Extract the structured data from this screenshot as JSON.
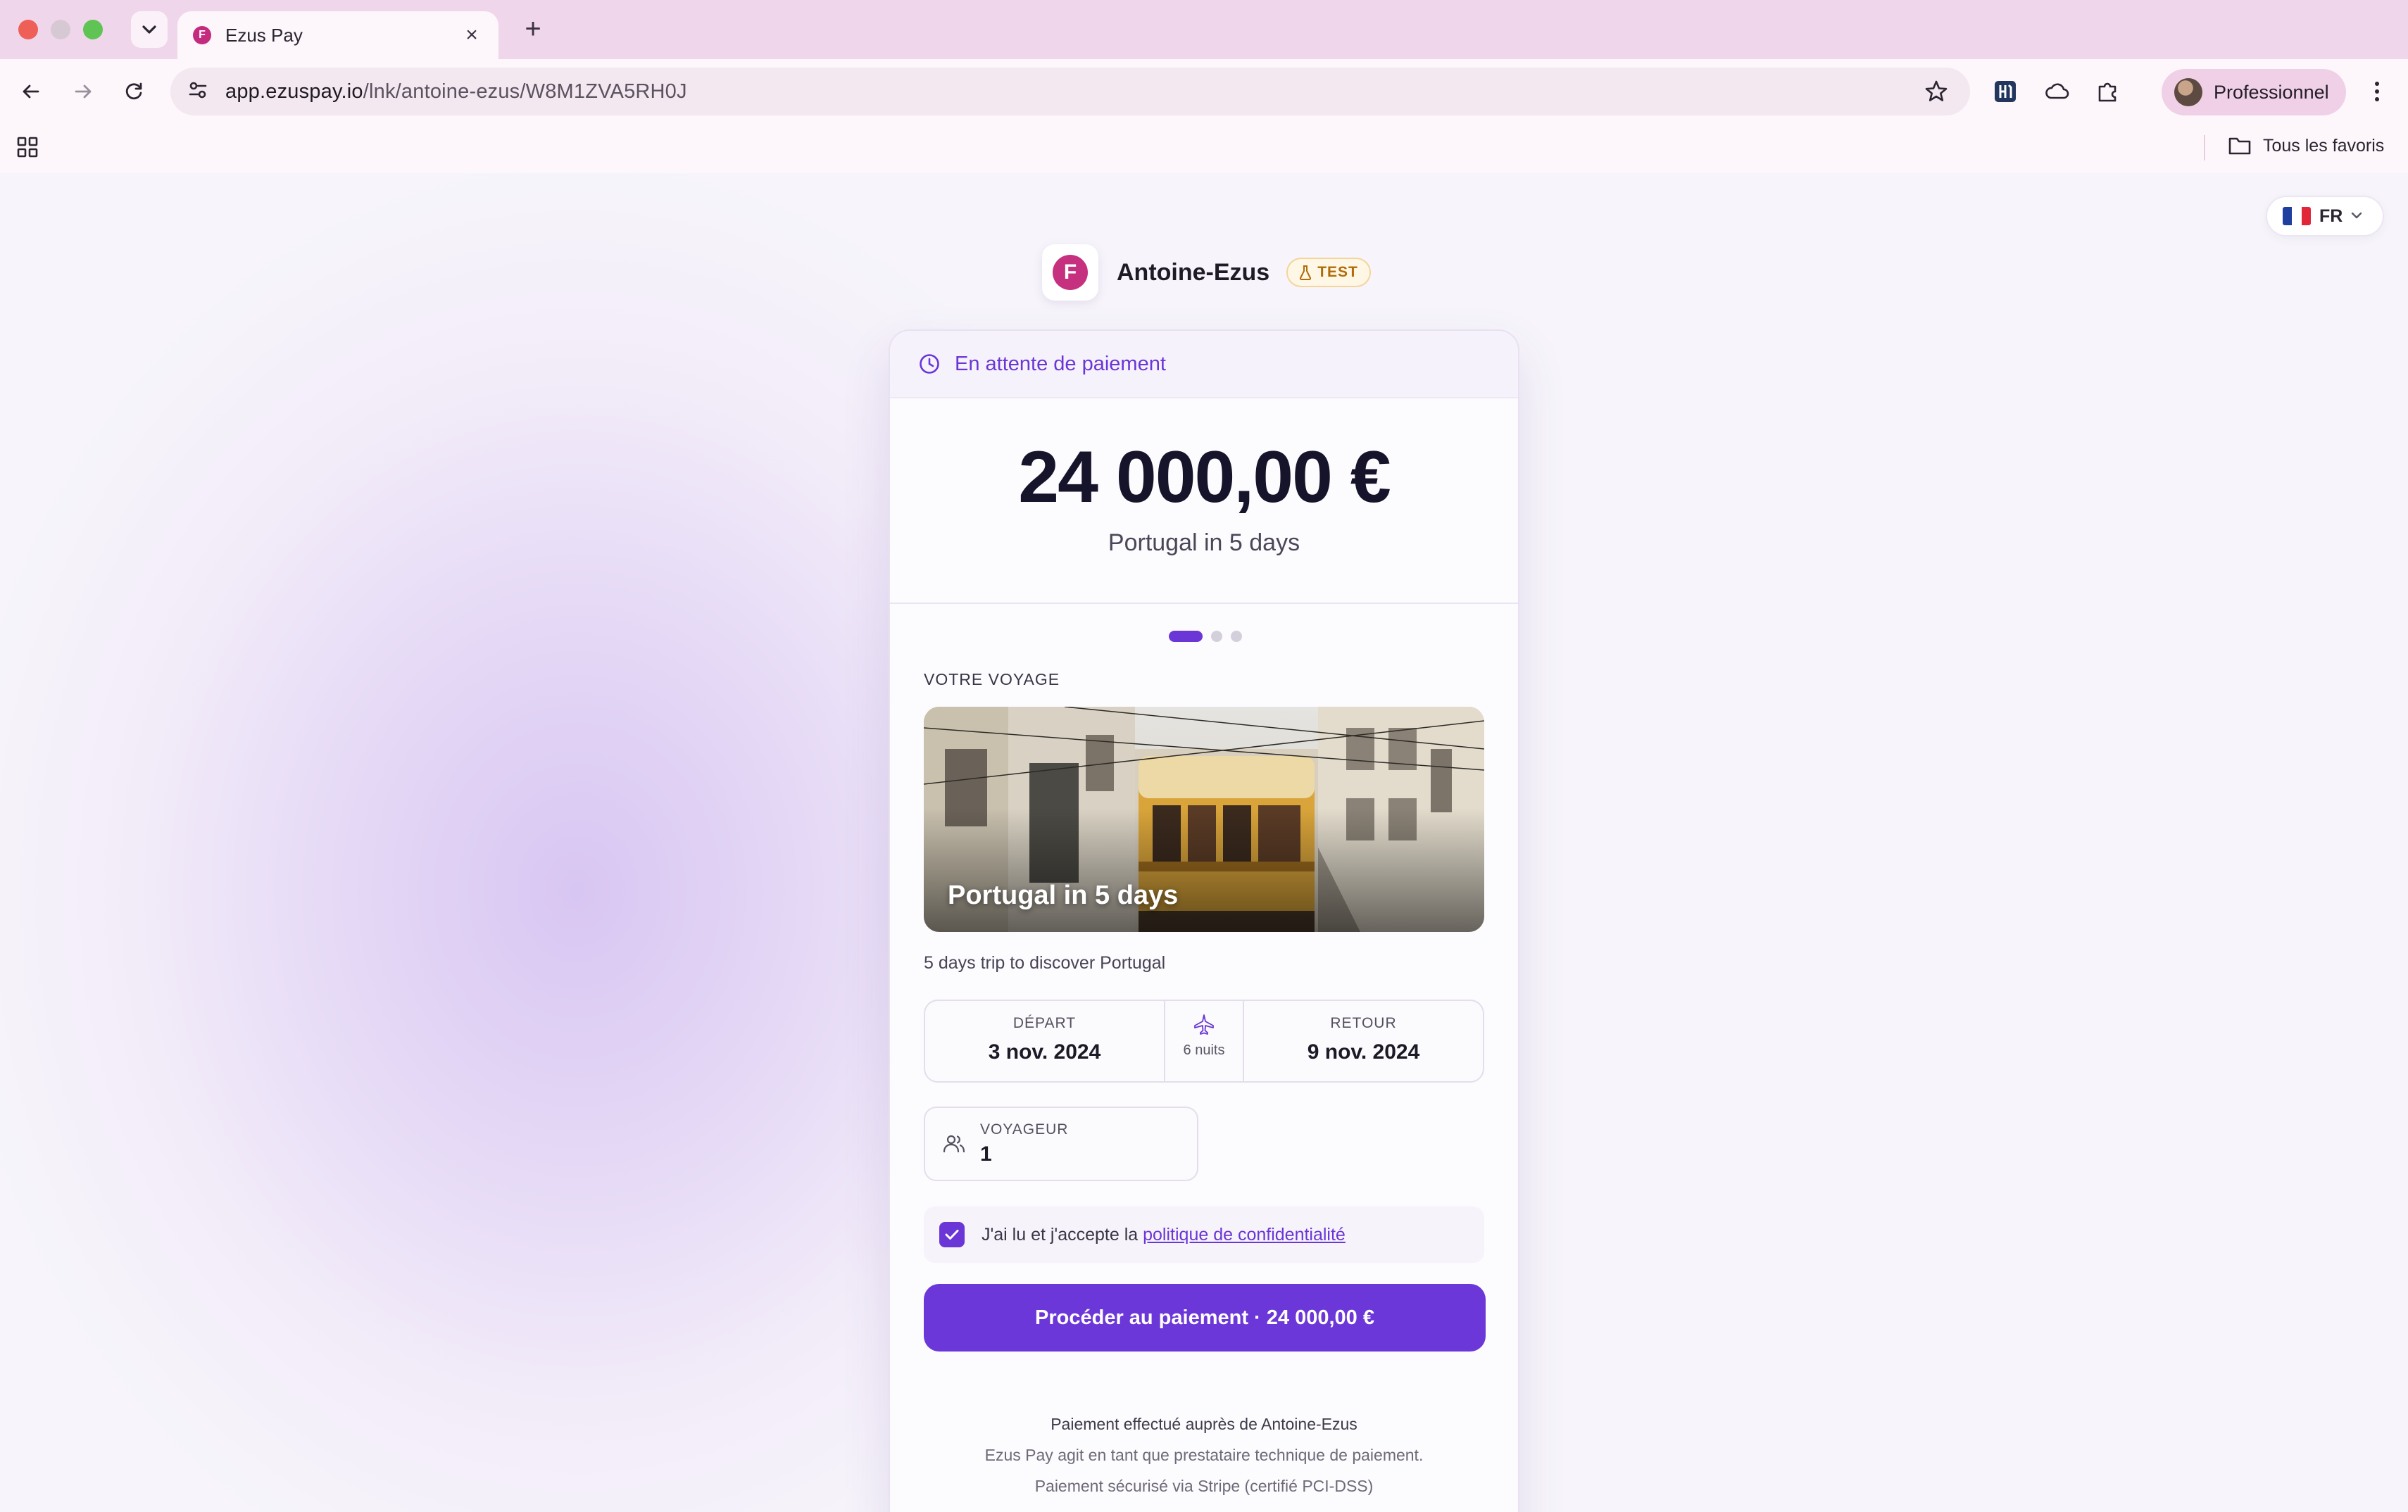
{
  "browser": {
    "tab_title": "Ezus Pay",
    "favicon_letter": "F",
    "url_host": "app.ezuspay.io",
    "url_path": "/lnk/antoine-ezus/W8M1ZVA5RH0J",
    "profile_label": "Professionnel",
    "bookmarks_folder": "Tous les favoris",
    "icons": [
      "tab-search-icon",
      "close-icon",
      "plus-icon",
      "back-icon",
      "forward-icon",
      "reload-icon",
      "site-info-icon",
      "star-icon",
      "extension-icon",
      "cloud-icon",
      "puzzle-icon",
      "kebab-menu-icon",
      "apps-grid-icon",
      "folder-icon"
    ]
  },
  "page": {
    "language": {
      "code": "FR",
      "flag": [
        "#1e3fa0",
        "#ffffff",
        "#e2263a"
      ]
    },
    "merchant": {
      "logo_letter": "F",
      "name": "Antoine-Ezus",
      "badge": "TEST"
    },
    "status": "En attente de paiement",
    "amount": "24 000,00 €",
    "amount_subtitle": "Portugal in 5 days",
    "steps": {
      "current": 1,
      "total": 3
    },
    "section_label": "VOTRE VOYAGE",
    "trip": {
      "title": "Portugal in 5 days",
      "description": "5 days trip to discover Portugal",
      "departure_label": "DÉPART",
      "departure_date": "3 nov. 2024",
      "nights": "6 nuits",
      "return_label": "RETOUR",
      "return_date": "9 nov. 2024"
    },
    "traveler": {
      "label": "VOYAGEUR",
      "value": "1"
    },
    "consent": {
      "checked": true,
      "text": "J'ai lu et j'accepte la ",
      "link": "politique de confidentialité"
    },
    "pay_button": "Procéder au paiement · 24 000,00 €",
    "footer": {
      "line1": "Paiement effectué auprès de Antoine-Ezus",
      "line2": "Ezus Pay agit en tant que prestataire technique de paiement.",
      "line3": "Paiement sécurisé via Stripe (certifié PCI-DSS)"
    },
    "colors": {
      "accent": "#6c37d8",
      "brand": "#c5317f",
      "test_badge": "#b06b07"
    }
  }
}
